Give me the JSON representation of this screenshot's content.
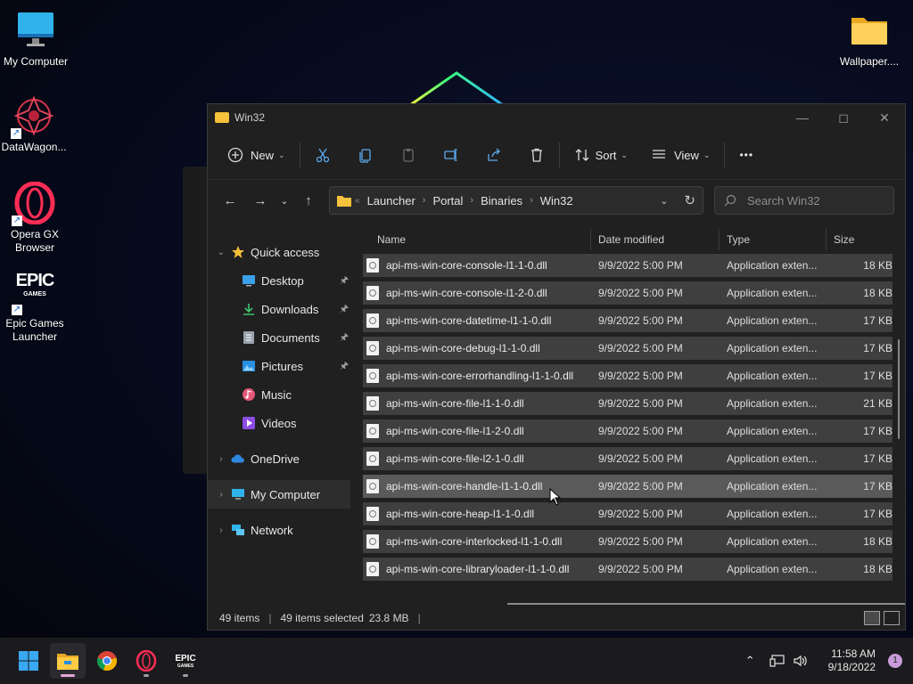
{
  "desktop": {
    "icons": [
      {
        "label": "My Computer",
        "icon": "monitor-icon"
      },
      {
        "label": "DataWagon...",
        "icon": "datawagon-icon"
      },
      {
        "label": "Opera GX Browser",
        "icon": "opera-gx-icon"
      },
      {
        "label": "Epic Games Launcher",
        "icon": "epic-games-icon"
      },
      {
        "label": "Wallpaper....",
        "icon": "folder-icon"
      }
    ],
    "epic_logo_text": "EPIC",
    "epic_logo_sub": "GAMES"
  },
  "window": {
    "title": "Win32",
    "toolbar": {
      "new_label": "New",
      "sort_label": "Sort",
      "view_label": "View",
      "more_label": "•••"
    },
    "breadcrumb": [
      "Launcher",
      "Portal",
      "Binaries",
      "Win32"
    ],
    "search_placeholder": "Search Win32",
    "nav": [
      {
        "label": "Quick access",
        "icon": "star-icon",
        "expand": "v",
        "level": 0
      },
      {
        "label": "Desktop",
        "icon": "desktop-icon",
        "pinned": true,
        "level": 1
      },
      {
        "label": "Downloads",
        "icon": "download-icon",
        "pinned": true,
        "level": 1
      },
      {
        "label": "Documents",
        "icon": "document-icon",
        "pinned": true,
        "level": 1
      },
      {
        "label": "Pictures",
        "icon": "pictures-icon",
        "pinned": true,
        "level": 1
      },
      {
        "label": "Music",
        "icon": "music-icon",
        "level": 1
      },
      {
        "label": "Videos",
        "icon": "videos-icon",
        "level": 1
      },
      {
        "label": "OneDrive",
        "icon": "cloud-icon",
        "expand": ">",
        "level": 0
      },
      {
        "label": "My Computer",
        "icon": "monitor-icon",
        "expand": ">",
        "level": 0,
        "selected": true
      },
      {
        "label": "Network",
        "icon": "network-icon",
        "expand": ">",
        "level": 0
      }
    ],
    "columns": {
      "name": "Name",
      "date": "Date modified",
      "type": "Type",
      "size": "Size"
    },
    "files": [
      {
        "name": "api-ms-win-core-console-l1-1-0.dll",
        "date": "9/9/2022 5:00 PM",
        "type": "Application exten...",
        "size": "18 KB"
      },
      {
        "name": "api-ms-win-core-console-l1-2-0.dll",
        "date": "9/9/2022 5:00 PM",
        "type": "Application exten...",
        "size": "18 KB"
      },
      {
        "name": "api-ms-win-core-datetime-l1-1-0.dll",
        "date": "9/9/2022 5:00 PM",
        "type": "Application exten...",
        "size": "17 KB"
      },
      {
        "name": "api-ms-win-core-debug-l1-1-0.dll",
        "date": "9/9/2022 5:00 PM",
        "type": "Application exten...",
        "size": "17 KB"
      },
      {
        "name": "api-ms-win-core-errorhandling-l1-1-0.dll",
        "date": "9/9/2022 5:00 PM",
        "type": "Application exten...",
        "size": "17 KB"
      },
      {
        "name": "api-ms-win-core-file-l1-1-0.dll",
        "date": "9/9/2022 5:00 PM",
        "type": "Application exten...",
        "size": "21 KB"
      },
      {
        "name": "api-ms-win-core-file-l1-2-0.dll",
        "date": "9/9/2022 5:00 PM",
        "type": "Application exten...",
        "size": "17 KB"
      },
      {
        "name": "api-ms-win-core-file-l2-1-0.dll",
        "date": "9/9/2022 5:00 PM",
        "type": "Application exten...",
        "size": "17 KB"
      },
      {
        "name": "api-ms-win-core-handle-l1-1-0.dll",
        "date": "9/9/2022 5:00 PM",
        "type": "Application exten...",
        "size": "17 KB",
        "hover": true
      },
      {
        "name": "api-ms-win-core-heap-l1-1-0.dll",
        "date": "9/9/2022 5:00 PM",
        "type": "Application exten...",
        "size": "17 KB"
      },
      {
        "name": "api-ms-win-core-interlocked-l1-1-0.dll",
        "date": "9/9/2022 5:00 PM",
        "type": "Application exten...",
        "size": "18 KB"
      },
      {
        "name": "api-ms-win-core-libraryloader-l1-1-0.dll",
        "date": "9/9/2022 5:00 PM",
        "type": "Application exten...",
        "size": "18 KB"
      }
    ],
    "status": {
      "items": "49 items",
      "selected": "49 items selected",
      "size": "23.8 MB"
    }
  },
  "taskbar": {
    "apps": [
      {
        "name": "start",
        "icon": "windows-icon"
      },
      {
        "name": "file-explorer",
        "icon": "folder-icon",
        "active": true
      },
      {
        "name": "chrome",
        "icon": "chrome-icon"
      },
      {
        "name": "opera-gx",
        "icon": "opera-gx-icon",
        "running": true
      },
      {
        "name": "epic-games",
        "icon": "epic-games-icon",
        "running": true
      }
    ],
    "time": "11:58 AM",
    "date": "9/18/2022",
    "notification_count": "1"
  },
  "colors": {
    "window_bg": "#202020",
    "row_bg": "#3f3f3f",
    "row_hover": "#5a5a5a",
    "folder": "#f6c13b",
    "accent_pink": "#e7a7d6"
  }
}
